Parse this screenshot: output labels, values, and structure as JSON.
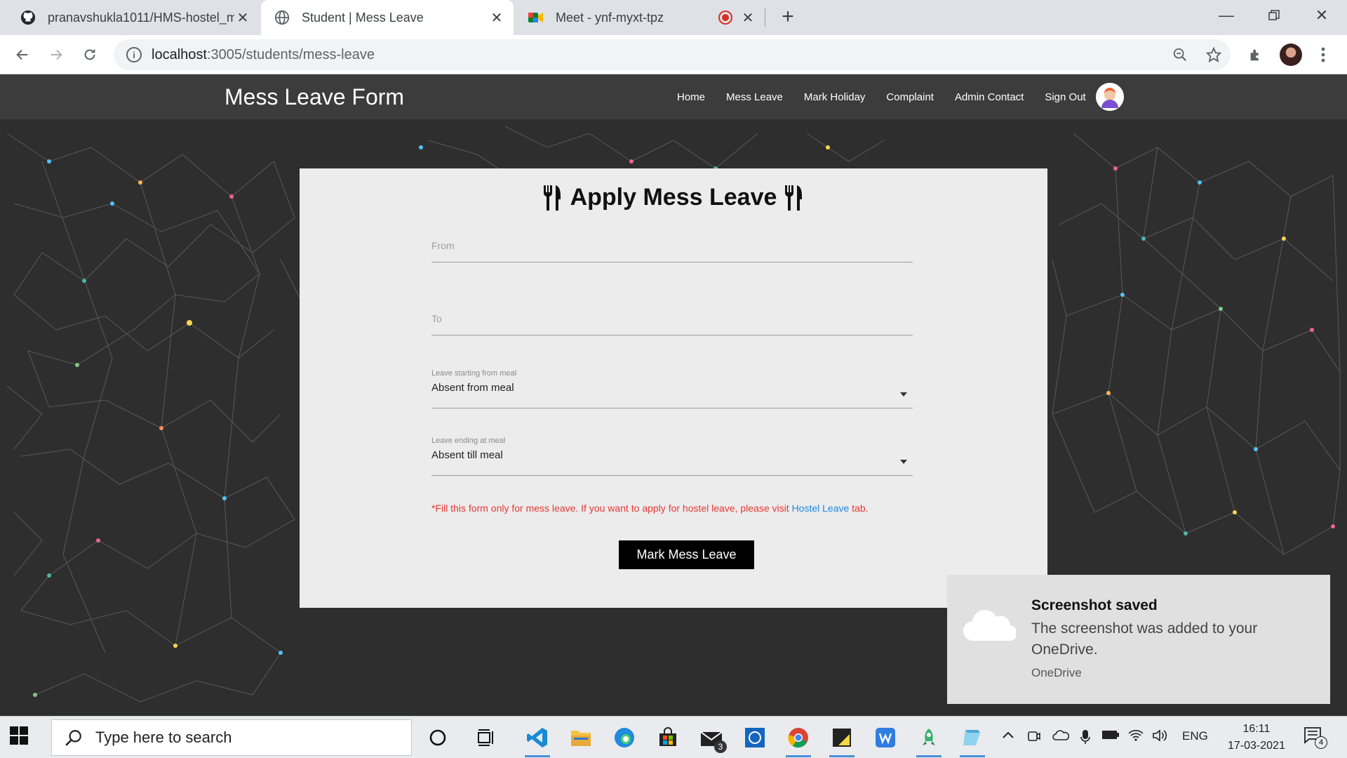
{
  "browser": {
    "tabs": [
      {
        "title": "pranavshukla1011/HMS-hostel_m",
        "icon": "github-icon"
      },
      {
        "title": "Student | Mess Leave",
        "icon": "globe-icon"
      },
      {
        "title": "Meet - ynf-myxt-tpz",
        "icon": "google-meet-icon"
      }
    ],
    "url_host": "localhost",
    "url_path": ":3005/students/mess-leave"
  },
  "navbar": {
    "brand": "Mess Leave Form",
    "links": [
      "Home",
      "Mess Leave",
      "Mark Holiday",
      "Complaint",
      "Admin Contact",
      "Sign Out"
    ]
  },
  "form": {
    "title": "Apply Mess Leave",
    "from_label": "From",
    "to_label": "To",
    "start_meal_label": "Leave starting from meal",
    "start_meal_value": "Absent from meal",
    "end_meal_label": "Leave ending at meal",
    "end_meal_value": "Absent till meal",
    "note_prefix": "*Fill this form only for mess leave. If you want to apply for hostel leave, please visit ",
    "note_link": "Hostel Leave",
    "note_suffix": " tab.",
    "submit_label": "Mark Mess Leave"
  },
  "toast": {
    "title": "Screenshot saved",
    "body": "The screenshot was added to your OneDrive.",
    "app": "OneDrive"
  },
  "taskbar": {
    "search_placeholder": "Type here to search",
    "mail_badge": "3",
    "language": "ENG",
    "time": "16:11",
    "date": "17-03-2021",
    "notification_count": "4"
  },
  "colors": {
    "accent_link": "#1e88e5",
    "note_red": "#e53935",
    "navbar_bg": "#3c3c3c",
    "card_bg": "#ececec"
  }
}
